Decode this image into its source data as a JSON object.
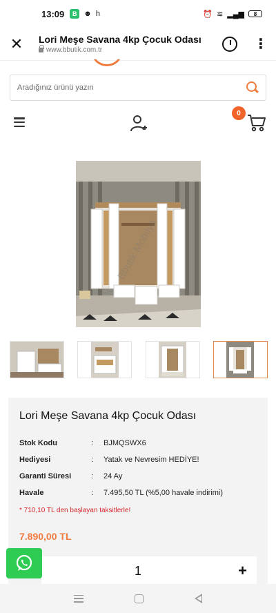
{
  "status_bar": {
    "time": "13:09",
    "notif_b": "B",
    "notif_h": "h",
    "battery": "8"
  },
  "browser": {
    "page_title": "Lori Meşe Savana 4kp Çocuk Odası",
    "url": "www.bbutik.com.tr"
  },
  "search": {
    "placeholder": "Aradığınız ürünü yazın"
  },
  "cart": {
    "count": "0"
  },
  "gallery": {
    "watermark": "Bbutik Mobilya",
    "thumbnails": [
      "thumbnail-1",
      "thumbnail-2",
      "thumbnail-3",
      "thumbnail-4"
    ],
    "active_thumbnail": 4
  },
  "product": {
    "title": "Lori Meşe Savana 4kp Çocuk Odası",
    "specs": [
      {
        "label": "Stok Kodu",
        "sep": ":",
        "value": "BJMQSWX6"
      },
      {
        "label": "Hediyesi",
        "sep": ":",
        "value": "Yatak ve Nevresim HEDİYE!"
      },
      {
        "label": "Garanti Süresi",
        "sep": ":",
        "value": "24 Ay"
      },
      {
        "label": "Havale",
        "sep": ":",
        "value": "7.495,50 TL (%5,00 havale indirimi)"
      }
    ],
    "installment_note": "* 710,10 TL den başlayan taksitlerle!",
    "price": "7.890,00 TL"
  },
  "quantity": {
    "value": "1",
    "plus": "+"
  },
  "colors": {
    "accent": "#f07b3f",
    "badge": "#f0642a",
    "whatsapp": "#2ecc52",
    "installment": "#d4282f"
  }
}
